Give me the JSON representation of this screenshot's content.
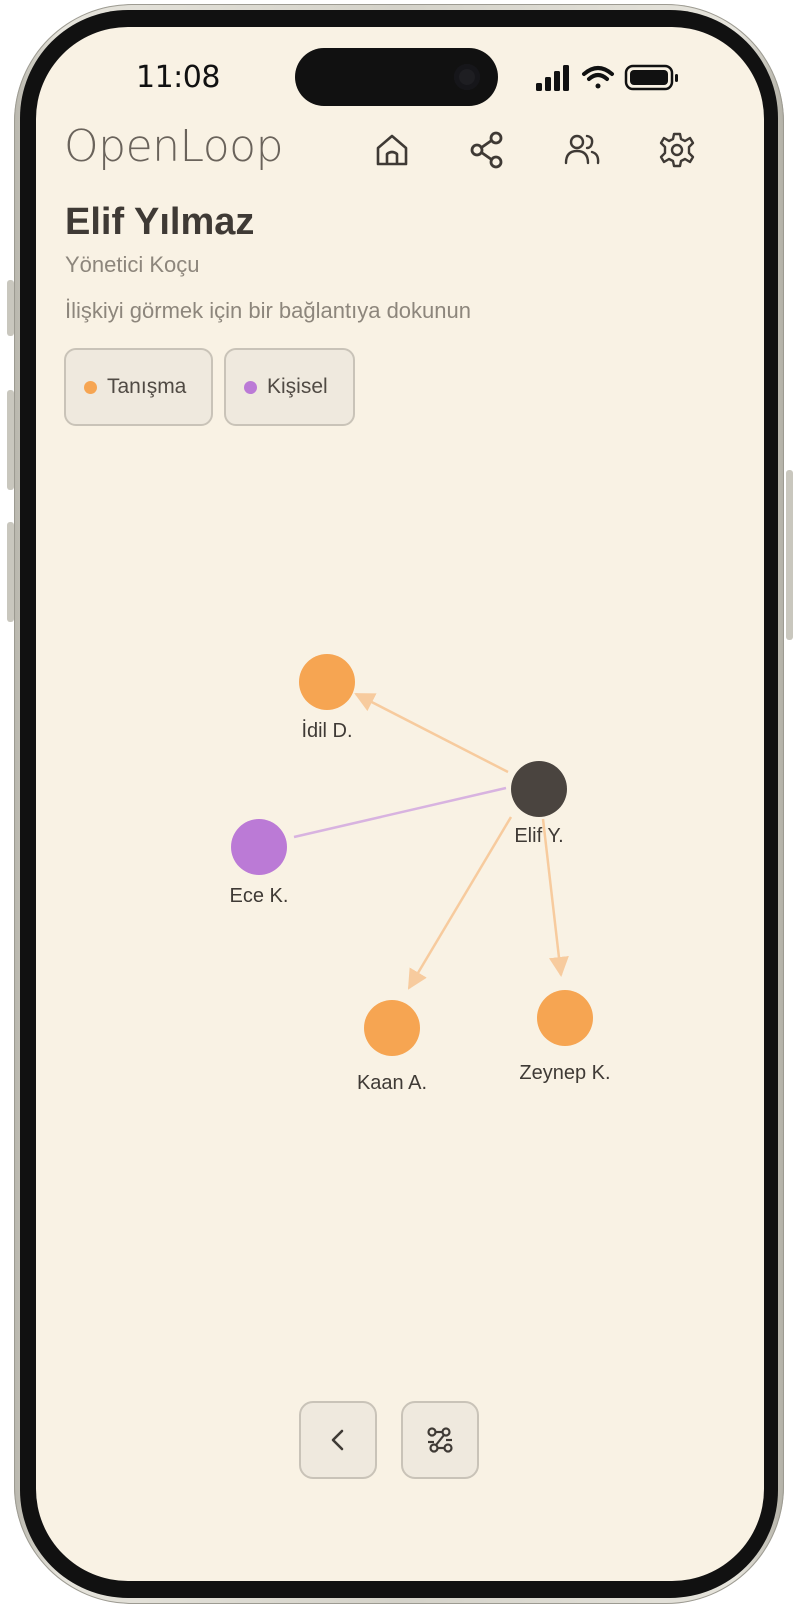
{
  "status_bar": {
    "time": "11:08"
  },
  "app": {
    "logo": "OpenLoop"
  },
  "nav": [
    {
      "name": "home-icon"
    },
    {
      "name": "share-icon"
    },
    {
      "name": "users-icon"
    },
    {
      "name": "gear-icon"
    }
  ],
  "profile": {
    "name": "Elif Yılmaz",
    "role": "Yönetici Koçu",
    "hint": "İlişkiyi görmek için bir bağlantıya dokunun"
  },
  "legend": [
    {
      "label": "Tanışma",
      "color": "#f6a552"
    },
    {
      "label": "Kişisel",
      "color": "#bb7ad6"
    }
  ],
  "graph": {
    "center": {
      "label": "Elif Y.",
      "color": "#4a443f"
    },
    "nodes": [
      {
        "label": "İdil D.",
        "type": "Tanışma",
        "color": "#f6a552"
      },
      {
        "label": "Ece K.",
        "type": "Kişisel",
        "color": "#bb7ad6"
      },
      {
        "label": "Kaan A.",
        "type": "Tanışma",
        "color": "#f6a552"
      },
      {
        "label": "Zeynep K.",
        "type": "Tanışma",
        "color": "#f6a552"
      }
    ],
    "edge_colors": {
      "Tanışma": "#f7cb9e",
      "Kişisel": "#d8b3e0"
    }
  },
  "bottom_buttons": [
    {
      "name": "chevron-left-icon"
    },
    {
      "name": "graph-layout-icon"
    }
  ]
}
